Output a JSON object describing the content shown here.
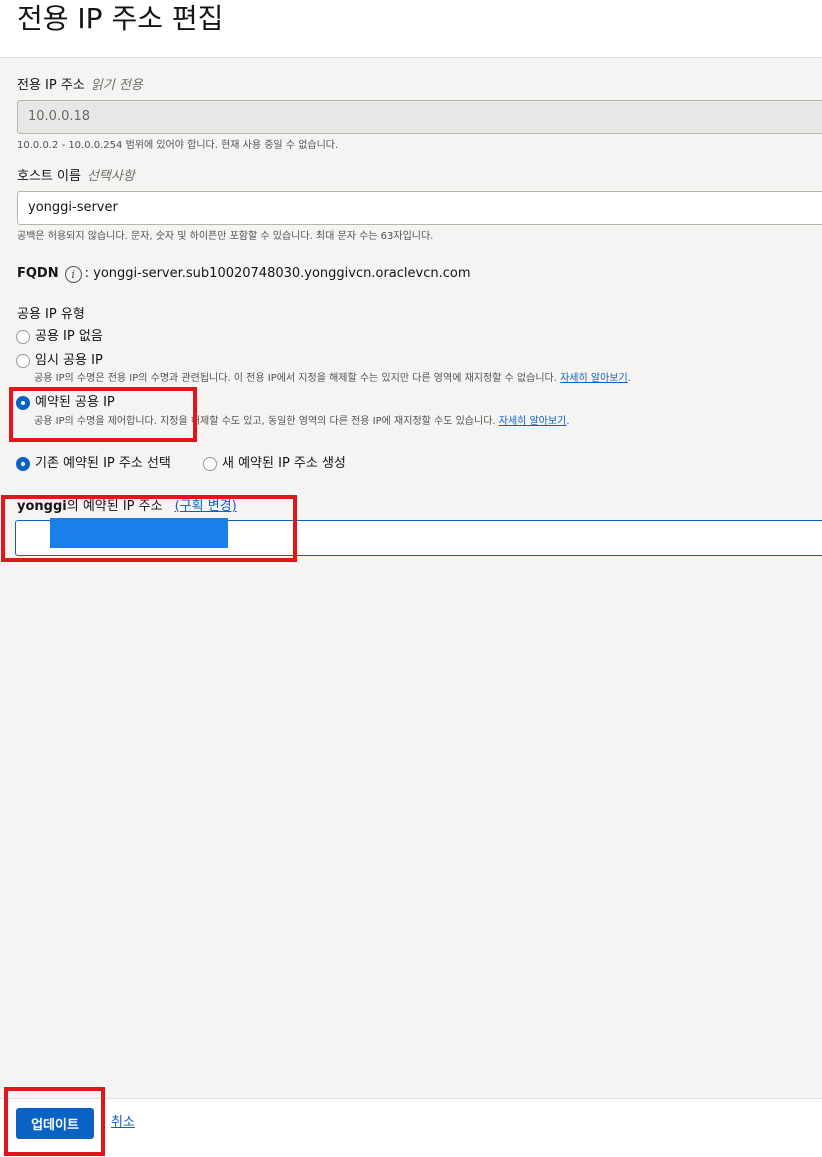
{
  "page": {
    "title": "전용 IP 주소 편집"
  },
  "private_ip": {
    "label": "전용 IP 주소",
    "optional_tag": "읽기 전용",
    "value": "10.0.0.18",
    "help": "10.0.0.2 - 10.0.0.254 범위에 있어야 합니다. 현재 사용 중일 수 없습니다."
  },
  "hostname": {
    "label": "호스트 이름",
    "optional_tag": "선택사항",
    "value": "yonggi-server",
    "help": "공백은 허용되지 않습니다. 문자, 숫자 및 하이픈만 포함할 수 있습니다. 최대 문자 수는 63자입니다."
  },
  "fqdn": {
    "label": "FQDN",
    "info_icon": "i",
    "value": ": yonggi-server.sub10020748030.yonggivcn.oraclevcn.com"
  },
  "public_ip_type": {
    "label": "공용 IP 유형",
    "options": [
      {
        "label": "공용 IP 없음",
        "checked": false
      },
      {
        "label": "임시 공용 IP",
        "checked": false,
        "help": "공용 IP의 수명은 전용 IP의 수명과 관련됩니다. 이 전용 IP에서 지정을 해제할 수는 있지만 다른 영역에 재지정할 수 없습니다.",
        "help_link": "자세히 알아보기"
      },
      {
        "label": "예약된 공용 IP",
        "checked": true,
        "help": "공용 IP의 수명을 제어합니다. 지정을 해제할 수도 있고, 동일한 영역의 다른 전용 IP에 재지정할 수도 있습니다.",
        "help_link": "자세히 알아보기"
      }
    ]
  },
  "reserved_source": {
    "options": [
      {
        "label": "기존 예약된 IP 주소 선택",
        "checked": true
      },
      {
        "label": "새 예약된 IP 주소 생성",
        "checked": false
      }
    ]
  },
  "reserved_ip": {
    "compartment": "yonggi",
    "label_suffix": "의 예약된 IP 주소",
    "change_link": "(구획 변경)"
  },
  "footer": {
    "update_label": "업데이트",
    "cancel_label": "취소"
  },
  "colors": {
    "accent": "#0a63c4",
    "annotation": "#e0161c",
    "selection": "#1a7fe8"
  }
}
